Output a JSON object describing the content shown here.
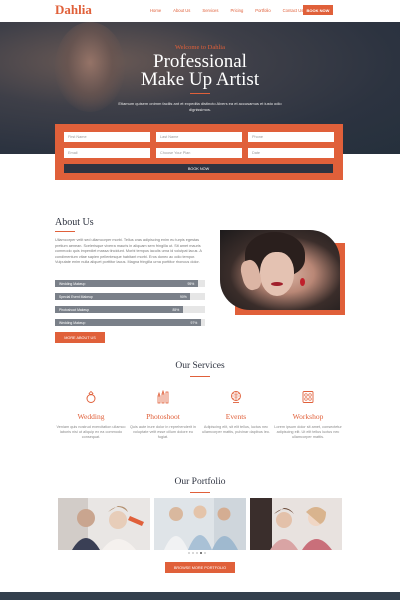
{
  "header": {
    "logo": "Dahlia",
    "nav": [
      "Home",
      "About Us",
      "Services",
      "Pricing",
      "Portfolio",
      "Contact Us"
    ],
    "book_button": "BOOK NOW"
  },
  "hero": {
    "subtitle": "Welcome to Dahlia",
    "title_line1": "Professional",
    "title_line2": "Make Up Artist",
    "text": "Etiamum quisem onimm facilis ant et expedita distincto Alvers ea et accusamus et iusto odio dignissimos."
  },
  "form": {
    "placeholders": [
      "First Name",
      "Last Name",
      "Phone",
      "Email",
      "Choose Your Plan",
      "Date"
    ],
    "button": "BOOK NOW"
  },
  "about": {
    "title": "About Us",
    "text": "Ullamcorper velit sed ullamcorper morbi. Tellus cras adipiscing enim eu turpis egestas pretium aenean. Scelerisque viverra mauris in aliquam sem fringilla ut. Sit amet mauris commodo quis imperdiet massa tincidunt. Morbi tempus iaculis urna id volutpat lacus. A condimentum vitae sapien pellentesque habitant morbi. Eros donec ac odio tempor. Vulputate enim nulla aliquet porttitor lacus. Magna fringilla urna porttitor rhoncus dolor.",
    "skills": [
      {
        "label": "Wedding Makeup",
        "pct": 95,
        "pct_text": "95%"
      },
      {
        "label": "Special Event Makeup",
        "pct": 90,
        "pct_text": "90%"
      },
      {
        "label": "Photoshoot Makeup",
        "pct": 85,
        "pct_text": "85%"
      },
      {
        "label": "Wedding Makeup",
        "pct": 97,
        "pct_text": "97%"
      }
    ],
    "more_button": "MORE ABOUT US"
  },
  "services": {
    "title": "Our Services",
    "items": [
      {
        "icon": "ring-icon",
        "name": "Wedding",
        "text": "Veniam quis nostrud exercitation ullamco laboris nisi ut aliquip ex ea commodo consequat."
      },
      {
        "icon": "makeup-brushes-icon",
        "name": "Photoshoot",
        "text": "Quis aute irure dolor in reprehenderit in voluptate velit esse cillum dolore eu fugiat."
      },
      {
        "icon": "disco-ball-icon",
        "name": "Events",
        "text": "Adipiscing elit, sit elit tellus, luctus nec ullamcorper mattis, pulvinar dapibus leo."
      },
      {
        "icon": "makeup-palette-icon",
        "name": "Workshop",
        "text": "Lorem ipsum dolor sit amet, consectetur adipiscing elit. Ut elit tellus luctus nec ullamcorper mattis."
      }
    ]
  },
  "portfolio": {
    "title": "Our Portfolio",
    "button": "BROWSE MORE PORTFOLIO"
  },
  "colors": {
    "accent": "#e0603a",
    "dark": "#2e3340"
  }
}
